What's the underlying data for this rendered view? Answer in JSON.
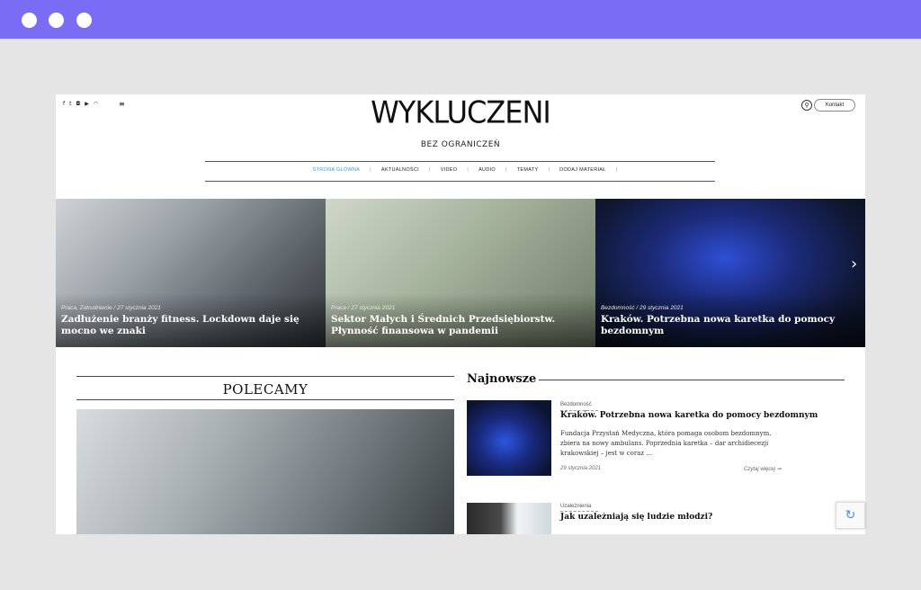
{
  "browser": {
    "window_controls": [
      "close",
      "minimize",
      "maximize"
    ]
  },
  "header": {
    "logo_text": "WYKLUCZENI",
    "tagline": "BEZ OGRANICZEŃ",
    "social_icons": [
      "facebook-icon",
      "twitter-icon",
      "instagram-icon",
      "youtube-icon",
      "rss-icon"
    ],
    "search_icon": "⚲",
    "contact_label": "Kontakt",
    "menu_icon": "≡"
  },
  "nav": {
    "items": [
      {
        "label": "STRONA GŁÓWNA",
        "active": true
      },
      {
        "label": "AKTUALNOŚCI"
      },
      {
        "label": "VIDEO"
      },
      {
        "label": "AUDIO"
      },
      {
        "label": "TEMATY"
      },
      {
        "label": "DODAJ MATERIAŁ"
      }
    ]
  },
  "slider": {
    "slides": [
      {
        "meta": "Praca, Zatrudnienie / 27 stycznia 2021",
        "title": "Zadłużenie branży fitness. Lockdown daje się mocno we znaki"
      },
      {
        "meta": "Praca / 27 stycznia 2021",
        "title": "Sektor Małych i Średnich Przedsiębiorstw. Płynność finansowa w pandemii"
      },
      {
        "meta": "Bezdomność / 29 stycznia 2021",
        "title": "Kraków. Potrzebna nowa karetka do pomocy bezdomnym"
      }
    ],
    "next_icon": "›"
  },
  "polecamy": {
    "title": "POLECAMY"
  },
  "najnowsze": {
    "title": "Najnowsze",
    "articles": [
      {
        "category": "Bezdomność",
        "title": "Kraków. Potrzebna nowa karetka do pomocy bezdomnym",
        "excerpt": "Fundacja Przystań Medyczna, która pomaga osobom bezdomnym, zbiera na nowy ambulans. Poprzednia karetka – dar archidiecezji krakowskiej – jest w coraz ...",
        "date": "29 stycznia 2021",
        "more": "Czytaj więcej ➞"
      },
      {
        "category": "Uzależnienia",
        "title": "Jak uzależniają się ludzie młodzi?"
      }
    ]
  },
  "recaptcha_icon": "↻"
}
